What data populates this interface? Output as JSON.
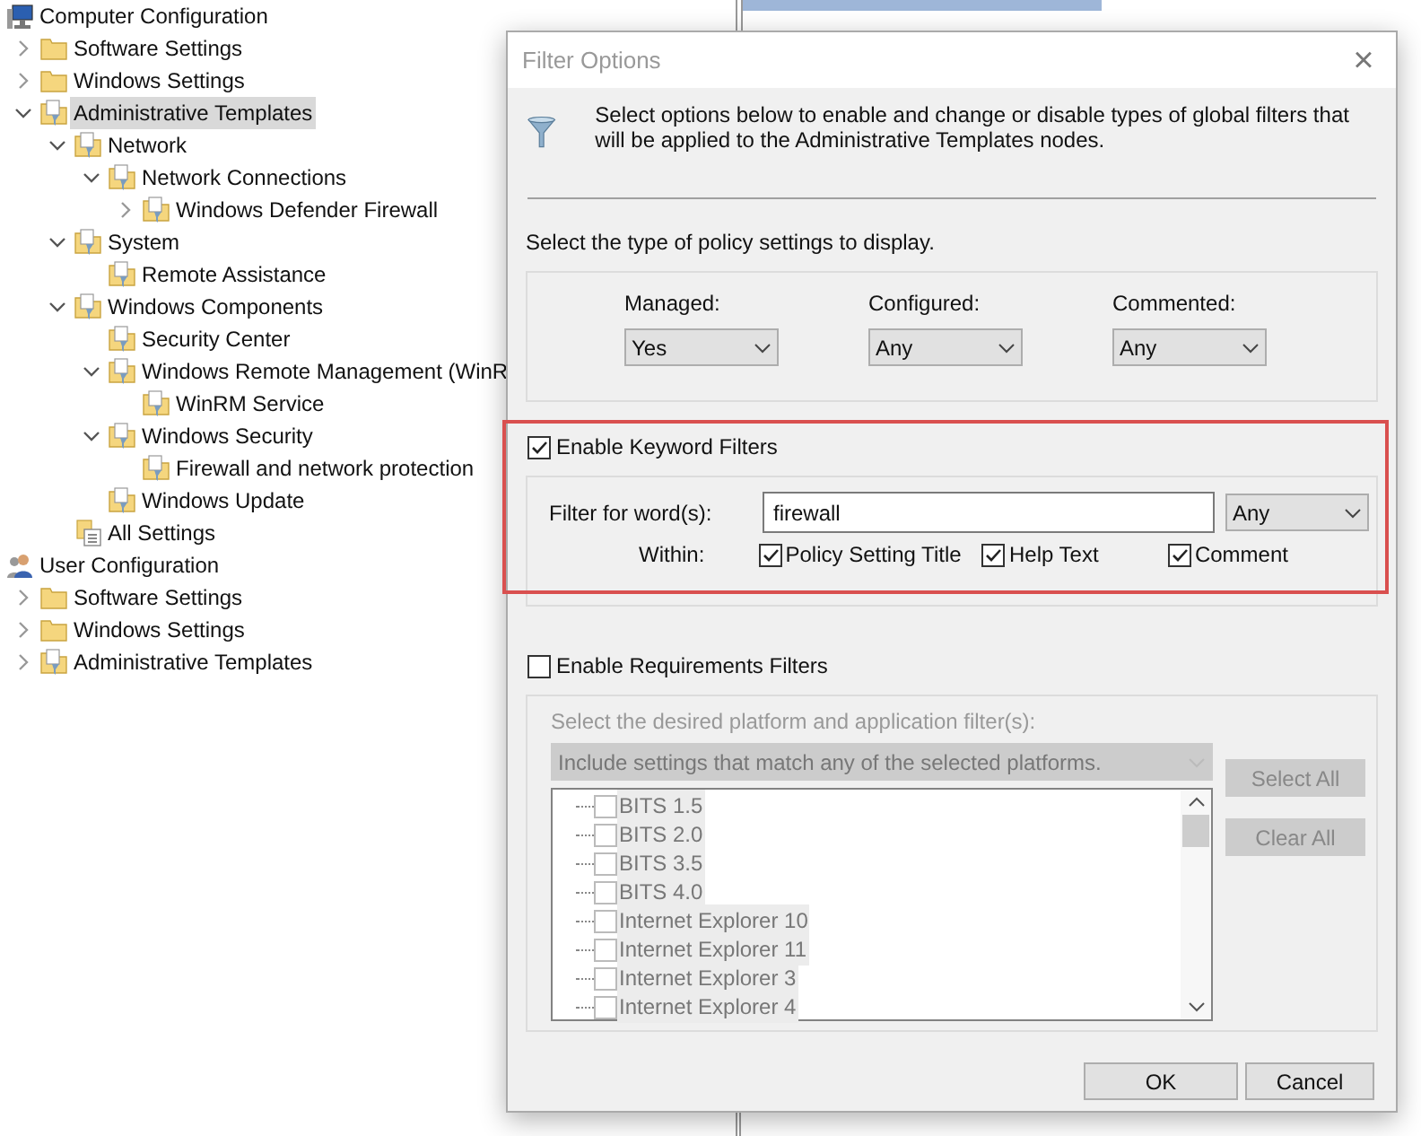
{
  "tree": [
    {
      "label": "Computer Configuration",
      "kind": "computer",
      "selected": false,
      "children": [
        {
          "label": "Software Settings",
          "kind": "folder",
          "expanded": false,
          "selected": false
        },
        {
          "label": "Windows Settings",
          "kind": "folder",
          "expanded": false,
          "selected": false
        },
        {
          "label": "Administrative Templates",
          "kind": "policy",
          "expanded": true,
          "selected": true,
          "children": [
            {
              "label": "Network",
              "kind": "policy",
              "expanded": true,
              "selected": false,
              "children": [
                {
                  "label": "Network Connections",
                  "kind": "policy",
                  "expanded": true,
                  "selected": false,
                  "children": [
                    {
                      "label": "Windows Defender Firewall",
                      "kind": "policy",
                      "expanded": false,
                      "selected": false
                    }
                  ]
                }
              ]
            },
            {
              "label": "System",
              "kind": "policy",
              "expanded": true,
              "selected": false,
              "children": [
                {
                  "label": "Remote Assistance",
                  "kind": "policy",
                  "selected": false
                }
              ]
            },
            {
              "label": "Windows Components",
              "kind": "policy",
              "expanded": true,
              "selected": false,
              "children": [
                {
                  "label": "Security Center",
                  "kind": "policy",
                  "selected": false
                },
                {
                  "label": "Windows Remote Management (WinR",
                  "kind": "policy",
                  "expanded": true,
                  "selected": false,
                  "children": [
                    {
                      "label": "WinRM Service",
                      "kind": "policy",
                      "selected": false
                    }
                  ]
                },
                {
                  "label": "Windows Security",
                  "kind": "policy",
                  "expanded": true,
                  "selected": false,
                  "children": [
                    {
                      "label": "Firewall and network protection",
                      "kind": "policy",
                      "selected": false
                    }
                  ]
                },
                {
                  "label": "Windows Update",
                  "kind": "policy",
                  "selected": false
                }
              ]
            },
            {
              "label": "All Settings",
              "kind": "settings",
              "selected": false
            }
          ]
        }
      ]
    },
    {
      "label": "User Configuration",
      "kind": "user",
      "selected": false,
      "children": [
        {
          "label": "Software Settings",
          "kind": "folder",
          "expanded": false,
          "selected": false
        },
        {
          "label": "Windows Settings",
          "kind": "folder",
          "expanded": false,
          "selected": false
        },
        {
          "label": "Administrative Templates",
          "kind": "policy",
          "expanded": false,
          "selected": false
        }
      ]
    }
  ],
  "dialog": {
    "title": "Filter Options",
    "close": "×",
    "description": "Select options below to enable and change or disable types of global filters that will be applied to the Administrative Templates nodes.",
    "policy_prompt": "Select the type of policy settings to display.",
    "policy_filters": [
      {
        "label": "Managed:",
        "value": "Yes"
      },
      {
        "label": "Configured:",
        "value": "Any"
      },
      {
        "label": "Commented:",
        "value": "Any"
      }
    ],
    "keyword": {
      "label": "Enable Keyword Filters",
      "checked": true,
      "word_label": "Filter for word(s):",
      "value": "firewall",
      "match": "Any",
      "within_label": "Within:",
      "within": [
        {
          "label": "Policy Setting Title",
          "checked": true
        },
        {
          "label": "Help Text",
          "checked": true
        },
        {
          "label": "Comment",
          "checked": true
        }
      ]
    },
    "requirements": {
      "label": "Enable Requirements Filters",
      "checked": false,
      "prompt": "Select the desired platform and application filter(s):",
      "mode": "Include settings that match any of the selected platforms.",
      "platforms": [
        {
          "label": "BITS 1.5",
          "checked": false
        },
        {
          "label": "BITS 2.0",
          "checked": false
        },
        {
          "label": "BITS 3.5",
          "checked": false
        },
        {
          "label": "BITS 4.0",
          "checked": false
        },
        {
          "label": "Internet Explorer 10",
          "checked": false
        },
        {
          "label": "Internet Explorer 11",
          "checked": false
        },
        {
          "label": "Internet Explorer 3",
          "checked": false
        },
        {
          "label": "Internet Explorer 4",
          "checked": false
        }
      ],
      "buttons": [
        "Select All",
        "Clear All"
      ]
    },
    "buttons": [
      "OK",
      "Cancel"
    ]
  }
}
